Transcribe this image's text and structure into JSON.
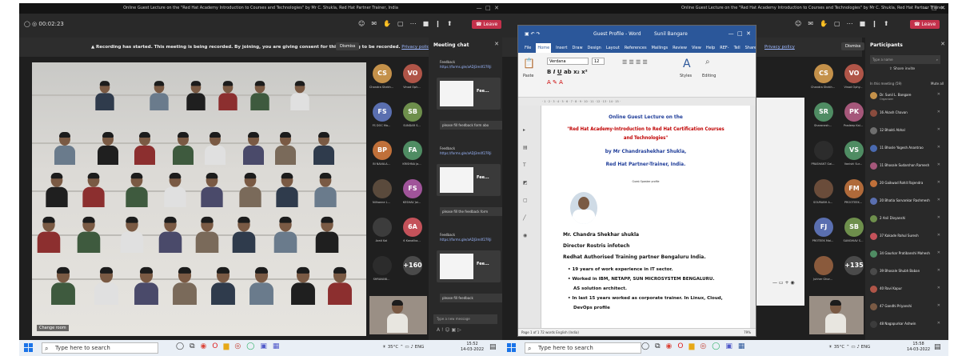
{
  "left_window": {
    "title": "Online Guest Lecture on the \"Red Hat Academy Introduction to Courses and Technologies\" by Mr C. Shukla, Red Hat Partner Trainer, India",
    "timer": "00:02:23",
    "leave_label": "Leave",
    "recording_notice": "Recording has started. This meeting is being recorded. By joining, you are giving consent for this meeting to be recorded.",
    "privacy_link": "Privacy policy",
    "dismiss_label": "Dismiss",
    "video_label": "Change room",
    "tiles": [
      {
        "initials": "CS",
        "name": "Chandra Shekh...",
        "color": "#c4914a"
      },
      {
        "initials": "VO",
        "name": "Vinod Oph...",
        "color": "#b05548"
      },
      {
        "initials": "FS",
        "name": "FS DOC Ma...",
        "color": "#5a6fb0"
      },
      {
        "initials": "SB",
        "name": "SUNDAR S...",
        "color": "#6e8f4c"
      },
      {
        "initials": "BP",
        "name": "BI NAVALA...",
        "color": "#c0703a"
      },
      {
        "initials": "FA",
        "name": "KRISHNA Ja...",
        "color": "#4f8c63"
      },
      {
        "initials": "",
        "name": "Nilhanne L...",
        "color": "#5a4a3c"
      },
      {
        "initials": "FS",
        "name": "KESHAV Jai...",
        "color": "#a0549a"
      },
      {
        "initials": "",
        "name": "Arati Kal",
        "color": "#3c3c3c"
      },
      {
        "initials": "6A",
        "name": "6 Kanalika...",
        "color": "#c4525a"
      },
      {
        "initials": "",
        "name": "SHRAVANI...",
        "color": "#2c2c2c"
      },
      {
        "initials": "+160",
        "name": "",
        "color": "#4a4a4a"
      }
    ],
    "chat": {
      "title": "Meeting chat",
      "messages": [
        {
          "heading": "Feedback",
          "link": "https://forms.gle/aADJ3m4f27RJi",
          "card": "Fee...",
          "footer": "please fill feedback form abo"
        },
        {
          "heading": "Feedback",
          "link": "https://forms.gle/aADJ3m4f27RJi",
          "card": "Fee...",
          "footer": "please fill the feedback form"
        },
        {
          "heading": "Feedback",
          "link": "https://forms.gle/aADJ3m4f27RJi",
          "card": "Fee...",
          "footer": "please fill feedback"
        }
      ],
      "input_placeholder": "Type a new message"
    }
  },
  "right_window": {
    "title": "Online Guest Lecture on the \"Red Hat Academy Introduction to Courses and Technologies\" by Mr C. Shukla, Red Hat Partner Trainer, India",
    "leave_label": "Leave",
    "dismiss_label": "Dismiss",
    "privacy_link": "Privacy policy",
    "participants": {
      "title": "Participants",
      "search_placeholder": "Type a name",
      "share_invite": "Share invite",
      "section": "In this meeting (59)",
      "mute_all": "Mute all",
      "list": [
        {
          "name": "Dr. Sunil L. Bangare",
          "sub": "Organizer",
          "color": "#c4914a"
        },
        {
          "name": "16 Akash Chavan",
          "color": "#8a4c3e"
        },
        {
          "name": "12 Bhakti Abhal",
          "color": "#6e6e6e"
        },
        {
          "name": "11 Bhosle Yogesh Anantrao",
          "color": "#4a6ab0"
        },
        {
          "name": "11 Bhosale Sudarshan Ramesh",
          "color": "#a5577a"
        },
        {
          "name": "20 Gaikwad Rohit Rajendra",
          "color": "#c0703a"
        },
        {
          "name": "20 Bhatia Sarvankar Rashmesh",
          "color": "#5a6fb0"
        },
        {
          "name": "2 Anil Divyanshi",
          "color": "#6e8f4c"
        },
        {
          "name": "37 Kakade Rahul Suresh",
          "color": "#c4525a"
        },
        {
          "name": "34 Gaurkar Pratibanshi Mahesh",
          "color": "#4f8c63"
        },
        {
          "name": "39 Bhosale Shubh Baban",
          "color": "#4a4a4a"
        },
        {
          "name": "40 Ravi Kapur",
          "color": "#b05548"
        },
        {
          "name": "47 Gandhi Priyanshi",
          "color": "#7a5a44"
        },
        {
          "name": "48 Nagapurkar Ashwin",
          "color": "#3c3c3c"
        }
      ]
    },
    "tiles": [
      {
        "initials": "CS",
        "name": "Chandra Shekh...",
        "color": "#c4914a"
      },
      {
        "initials": "VO",
        "name": "Vinod Ophy...",
        "color": "#b05548"
      },
      {
        "initials": "SR",
        "name": "Sharanesh...",
        "color": "#4f8c63"
      },
      {
        "initials": "PK",
        "name": "Pradeep Kal...",
        "color": "#a5577a"
      },
      {
        "initials": "",
        "name": "PRASHANT Gai...",
        "color": "#2c2c2c"
      },
      {
        "initials": "VS",
        "name": "Vanishi Sur...",
        "color": "#4f8c63"
      },
      {
        "initials": "",
        "name": "SOURABH A...",
        "color": "#6a4c3a"
      },
      {
        "initials": "FM",
        "name": "PROOTEEK...",
        "color": "#b06a3a"
      },
      {
        "initials": "FJ",
        "name": "PROTEEK Mai...",
        "color": "#5a6fb0"
      },
      {
        "initials": "SB",
        "name": "SANGHIAV S...",
        "color": "#6e8f4c"
      },
      {
        "initials": "",
        "name": "Juhher Ghor...",
        "color": "#8a5a3c"
      },
      {
        "initials": "+135",
        "name": "",
        "color": "#4a4a4a"
      }
    ],
    "word": {
      "title": "Guest Profile - Word",
      "user": "Sunil Bangare",
      "tabs": [
        "File",
        "Home",
        "Insert",
        "Draw",
        "Design",
        "Layout",
        "References",
        "Mailings",
        "Review",
        "View",
        "Help",
        "REF-N-W"
      ],
      "tell_me": "Tell me",
      "share": "Share",
      "font": "Verdana",
      "font_size": "12",
      "paste_label": "Paste",
      "styles_label": "Styles",
      "editing_label": "Editing",
      "doc": {
        "line1": "Online Guest Lecture on the",
        "line2": "\"Red Hat Academy-Introduction to Red Hat Certification Courses",
        "line3": "and Technologies\"",
        "line4": "by Mr Chandrashekhar Shukla,",
        "line5": "Red Hat Partner-Trainer, India.",
        "small": "Guest Speaker profile",
        "name": "Mr. Chandra Shekhar shukla",
        "director": "Director Rostris infotech",
        "redhat": "Redhat Authorised Training partner Bengaluru India.",
        "bullets": [
          "19 years of work experience in IT sector.",
          "Worked in IBM, NETAPP, SUN MICROSYSTEM BENGALURU.",
          "AS solution architect.",
          "In last 15 years worked as corporate trainer. In Linux, Cloud,",
          "DevOps profile"
        ]
      },
      "status": "Page 1 of 1   72 words   English (India)",
      "zoom": "79%"
    }
  },
  "taskbar": {
    "search_placeholder": "Type here to search",
    "left_clock_time": "15:52",
    "left_clock_date": "14-03-2022",
    "right_clock_time": "15:58",
    "right_clock_date": "14-03-2022",
    "temperature": "35°C",
    "lang": "ENG"
  }
}
